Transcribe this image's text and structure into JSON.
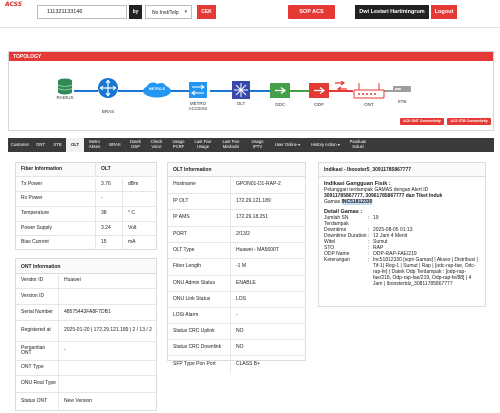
{
  "header": {
    "logo": "ACSS",
    "search_value": "111321133146",
    "by_label": "by",
    "select_value": "No Inet/Telp",
    "cek_label": "CEK",
    "sop_label": "SOP ACS",
    "user_name": "Dwi Lestari Hartiningrum",
    "logout_label": "Logout"
  },
  "topology": {
    "title": "TOPOLOGY",
    "nodes": {
      "radius": "RADIUS",
      "bras": "BRAS",
      "metro": "METRO-E",
      "metro_access": "METRO ACCESS",
      "olt": "OLT",
      "odc": "ODC",
      "odp": "ODP",
      "ont": "ONT",
      "stb": "STB"
    },
    "badges": {
      "ont_connectivity": "ACS ONT Connectivity",
      "stb_connectivity": "ACS STB Connectivity"
    },
    "colors": {
      "radius": "#2e8b57",
      "network": "#1976d2",
      "access": "#2196f3",
      "olt": "#3949ab",
      "odc": "#43a047",
      "odp": "#e53935",
      "ont": "#e53935",
      "stb": "#9e9e9e"
    }
  },
  "tabs": [
    {
      "label": "Customer"
    },
    {
      "label": "ONT"
    },
    {
      "label": "STB"
    },
    {
      "label": "OLT"
    },
    {
      "label": "Metro Akses"
    },
    {
      "label": "BRAS"
    },
    {
      "label": "Datek OSP"
    },
    {
      "label": "Check Voice"
    },
    {
      "label": "Usage PCRF"
    },
    {
      "label": "Last Five Usage"
    },
    {
      "label": "Last Five Minitools"
    },
    {
      "label": "Usage IPTV"
    },
    {
      "label": "User Online ▾"
    },
    {
      "label": "History Action ▾"
    },
    {
      "label": "Panduan Solusi"
    }
  ],
  "active_tab": "OLT",
  "fiber": {
    "title": "Fiber Information",
    "col": "OLT",
    "rows": [
      {
        "label": "Tx Power",
        "value": "3.76",
        "unit": "dBm"
      },
      {
        "label": "Rx Power",
        "value": "-",
        "unit": ""
      },
      {
        "label": "Temperature",
        "value": "38",
        "unit": "° C"
      },
      {
        "label": "Power Supply",
        "value": "3.24",
        "unit": "Volt"
      },
      {
        "label": "Bias Current",
        "value": "15",
        "unit": "mA"
      }
    ]
  },
  "ont_info": {
    "title": "ONT Information",
    "rows": [
      {
        "label": "Vendor ID",
        "value": "Huawei"
      },
      {
        "label": "Version ID",
        "value": ""
      },
      {
        "label": "Serial Number",
        "value": "48575443FA8F7DB1"
      },
      {
        "label": "Registered at",
        "value": "2025-01-20 | 172.29.121.189 | 2 / 13 / 2"
      },
      {
        "label": "Pergantian ONT",
        "value": "-"
      },
      {
        "label": "ONT Type",
        "value": ""
      },
      {
        "label": "ONU Real Type",
        "value": ""
      },
      {
        "label": "Status ONT",
        "value": "New Version"
      }
    ]
  },
  "olt_info": {
    "title": "OLT Information",
    "rows": [
      {
        "label": "Hostname",
        "value": "GPON01-D1-RAP-2"
      },
      {
        "label": "IP OLT",
        "value": "172.29.121.189"
      },
      {
        "label": "IP AMS",
        "value": "172.29.18.251"
      },
      {
        "label": "PORT",
        "value": "2/13/2"
      },
      {
        "label": "OLT Type",
        "value": "Huawei - MA5600T"
      },
      {
        "label": "Fiber Length",
        "value": "-1 M"
      },
      {
        "label": "ONU Admin Status",
        "value": "ENABLE"
      },
      {
        "label": "ONU Link Status",
        "value": "LOS"
      },
      {
        "label": "LOSi Alarm",
        "value": "-"
      },
      {
        "label": "Status CRC Uplink",
        "value": "NO"
      },
      {
        "label": "Status CRC Downlink",
        "value": "NO"
      },
      {
        "label": "SFP Type Pon Port",
        "value": "CLASS B+"
      }
    ]
  },
  "indikasi": {
    "title": "Indikasi - Ibooster5_30911785867777",
    "gangguan_heading": "Indikasi Gangguan Fisik :",
    "gangguan_line1": "Pelanggan terdampak GAMAS dengan Alert ID",
    "gangguan_line2": "30911785867777, 30961785867777 dan Tiket Induk",
    "gangguan_line3a": "Gamas ",
    "gangguan_ticket": "INC51812330",
    "detail_heading": "Detail Gamas :",
    "details": [
      {
        "k": "Jumlah SN Terdampak",
        "v": "19"
      },
      {
        "k": "Downtime",
        "v": "2025-08-05 01:13"
      },
      {
        "k": "Downtime Duration",
        "v": "12 Jam 4 Menit"
      },
      {
        "k": "Witel",
        "v": "Sumut"
      },
      {
        "k": "STO",
        "v": "RAP"
      },
      {
        "k": "ODP Name",
        "v": "ODP-RAP-FAE/219"
      }
    ],
    "keterangan_label": "Keterangan",
    "keterangan_value": "Inc51812330 [sqm Gamas] | Akses | Distribusi | Tif-1| Reg-1 | Sumut | Rap | [odc-rap-fae, Odc-rap-fe] | Datek Odp Terdampak : [odp-rap-fae/218, Odp-rap-fae/219, Odp-rap-fe/88] | 4 Jam | Iboostertdz_30811785867777"
  }
}
